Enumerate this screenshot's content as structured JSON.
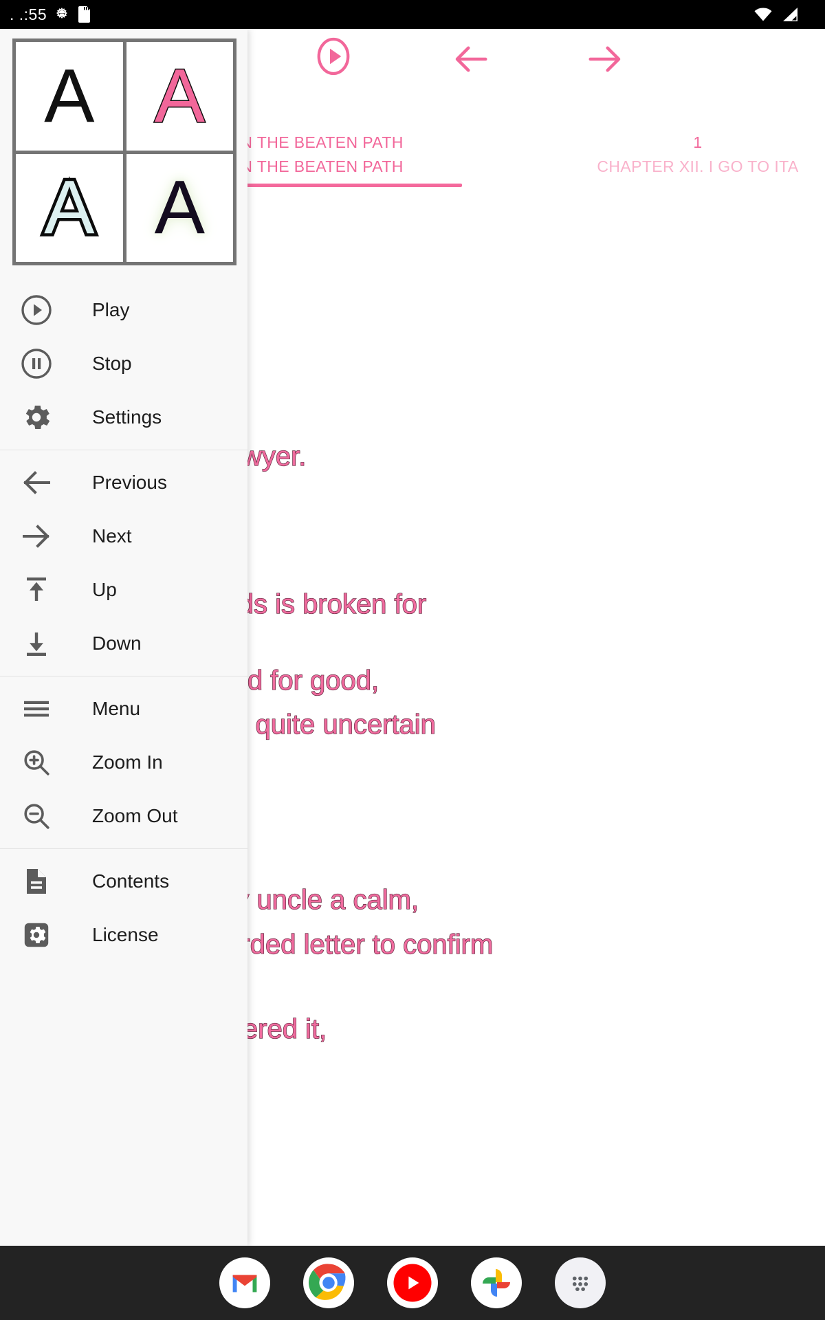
{
  "statusbar": {
    "clock": ". .:55",
    "left_icons": [
      "android-gear-icon",
      "sd-card-icon"
    ],
    "right_icons": [
      "wifi-icon",
      "cell-signal-icon"
    ]
  },
  "drawer": {
    "font_samples": [
      {
        "id": "style-plain",
        "glyph": "A",
        "style": "plain",
        "fill": "#111111",
        "outline": "none"
      },
      {
        "id": "style-pink",
        "glyph": "A",
        "style": "pink-outline",
        "fill": "#f2679a",
        "outline": "#111111"
      },
      {
        "id": "style-blue",
        "glyph": "A",
        "style": "blue-heavy-outline",
        "fill": "#dcf0f0",
        "outline": "#0b0b0b"
      },
      {
        "id": "style-glow",
        "glyph": "A",
        "style": "dark-green-glow",
        "fill": "#140c1f",
        "glow": "#e9f3dc"
      }
    ],
    "groups": [
      {
        "items": [
          {
            "label": "Play",
            "icon": "play-circle-icon"
          },
          {
            "label": "Stop",
            "icon": "pause-circle-icon"
          },
          {
            "label": "Settings",
            "icon": "gear-icon"
          }
        ]
      },
      {
        "items": [
          {
            "label": "Previous",
            "icon": "arrow-left-icon"
          },
          {
            "label": "Next",
            "icon": "arrow-right-icon"
          },
          {
            "label": "Up",
            "icon": "arrow-up-to-bar-icon"
          },
          {
            "label": "Down",
            "icon": "arrow-down-to-bar-icon"
          }
        ]
      },
      {
        "items": [
          {
            "label": "Menu",
            "icon": "hamburger-menu-icon"
          },
          {
            "label": "Zoom In",
            "icon": "magnifier-plus-icon"
          },
          {
            "label": "Zoom Out",
            "icon": "magnifier-minus-icon"
          }
        ]
      },
      {
        "items": [
          {
            "label": "Contents",
            "icon": "document-lines-icon"
          },
          {
            "label": "License",
            "icon": "gear-square-icon"
          }
        ]
      }
    ]
  },
  "reader": {
    "accent_color": "#f2679a",
    "accent_faint_color": "#f9b2cb",
    "toolbar": [
      {
        "name": "play",
        "icon": "play-circle-icon"
      },
      {
        "name": "previous",
        "icon": "arrow-left-icon"
      },
      {
        "name": "next",
        "icon": "arrow-right-icon"
      }
    ],
    "header": {
      "current_chapter": "APTER XI. IN THE BEATEN PATH",
      "current_chapter_tab": "APTER XI. IN THE BEATEN PATH",
      "page_number": "1",
      "next_chapter": "CHAPTER XII. I GO TO ITA"
    },
    "paragraphs": [
      "wyer.",
      "the Mouillards is broken for",
      "eated for good,",
      "or good—and quite uncertain",
      "ny uncle a calm,",
      "rly worded letter to confirm",
      "wered it,"
    ]
  },
  "dock": {
    "apps": [
      {
        "name": "gmail",
        "icon": "gmail-icon"
      },
      {
        "name": "chrome",
        "icon": "chrome-icon"
      },
      {
        "name": "youtube",
        "icon": "youtube-icon"
      },
      {
        "name": "photos",
        "icon": "google-photos-icon"
      },
      {
        "name": "all-apps",
        "icon": "app-drawer-icon"
      }
    ]
  }
}
